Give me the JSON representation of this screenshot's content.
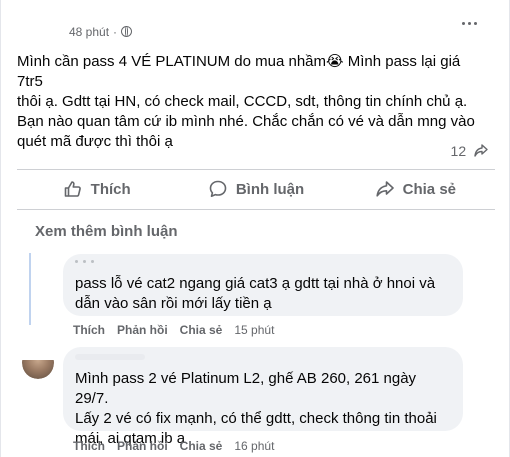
{
  "post": {
    "time": "48 phút",
    "dot": "·",
    "text_lines": [
      "Mình cần pass 4 VÉ PLATINUM do mua nhầm😭 Mình pass lại giá 7tr5",
      "thôi ạ. Gdtt tại HN, có check mail, CCCD, sdt, thông tin chính chủ ạ.",
      "Bạn nào quan tâm cứ ib mình nhé. Chắc chắn có vé và dẫn mng vào",
      "quét mã được thì thôi ạ"
    ],
    "share_count": "12"
  },
  "actions": {
    "like": "Thích",
    "comment": "Bình luận",
    "share": "Chia sẻ"
  },
  "comments_section": {
    "more_comments": "Xem thêm bình luận",
    "comments": [
      {
        "text_lines": [
          "pass lỗ vé cat2 ngang giá cat3 ạ gdtt tại nhà ở hnoi và",
          "dẫn vào sân rồi mới lấy tiền ạ"
        ],
        "like": "Thích",
        "reply": "Phản hồi",
        "share": "Chia sẻ",
        "time": "15 phút"
      },
      {
        "text_lines": [
          "Mình pass 2 vé Platinum L2, ghế AB 260, 261 ngày 29/7.",
          "Lấy 2 vé có fix mạnh, có thể gdtt, check thông tin thoải",
          "mái, ai qtam ib ạ"
        ],
        "like": "Thích",
        "reply": "Phản hồi",
        "share": "Chia sẻ",
        "time": "16 phút"
      }
    ]
  },
  "colors": {
    "secondary_text": "#65676b",
    "bubble_bg": "#f0f2f5",
    "thread_line": "#c0d3ef"
  },
  "icons": {
    "privacy": "globe-icon",
    "more": "more-horizontal-icon",
    "reshare": "share-arrows-icon",
    "like": "thumbs-up-icon",
    "comment": "comment-bubble-icon",
    "share": "share-arrow-icon"
  }
}
